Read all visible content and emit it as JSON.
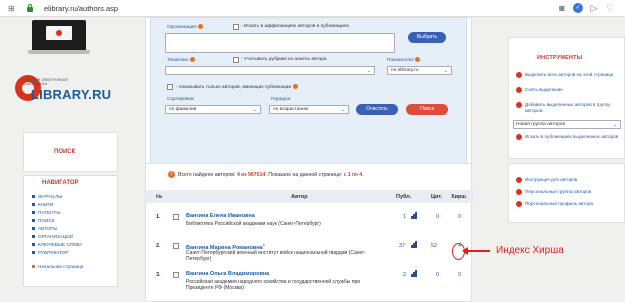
{
  "browser": {
    "url": "elibrary.ru/authors.asp",
    "grid_icon": "grid-icon",
    "lock_icon": "lock-icon"
  },
  "left": {
    "logo_small": "НАУЧНАЯ ЭЛЕКТРОННАЯ БИБЛИОТЕКА",
    "logo_main": "LIBRARY.RU",
    "search_label": "ПОИСК",
    "nav_title": "НАВИГАТОР",
    "nav_items": [
      "ЖУРНАЛЫ",
      "КНИГИ",
      "ПАТЕНТЫ",
      "ПОИСК",
      "АВТОРЫ",
      "ОРГАНИЗАЦИИ",
      "КЛЮЧЕВЫЕ СЛОВА",
      "РУБРИКАТОР"
    ],
    "home": "Начальная страница"
  },
  "form": {
    "org_label": "Организация:",
    "org_checkbox": "- Искать в аффилиациях авторов в публикациях",
    "choose_btn": "Выбрать",
    "topic_label": "Тематика:",
    "topic_checkbox": "- Учитывать рубрики из анкеты автора",
    "indicator_label": "Показатели:",
    "indicator_value": "по elibrary.ru",
    "show_only": "- показывать только авторов, имеющих публикации",
    "sort_label": "Сортировка:",
    "sort_value": "по фамилии",
    "order_label": "Порядок:",
    "order_value": "по возрастанию",
    "clear_btn": "Очистить",
    "search_btn": "Поиск"
  },
  "results": {
    "found_prefix": "Всего найдено авторов:",
    "found_count": "4",
    "found_of": "из",
    "found_total": "967014",
    "shown_text": ". Показано на данной странице: с",
    "shown_from": "1",
    "shown_to_text": "по",
    "shown_to": "4",
    "col_num": "№",
    "col_author": "Автор",
    "col_publ": "Публ.",
    "col_cit": "Цит.",
    "col_hirsh": "Хирш",
    "rows": [
      {
        "num": "1.",
        "name": "Вангина Елена Ивановна",
        "org": "Библиотека Российской академии наук (Санкт-Петербург)",
        "publ": "1",
        "cit": "0",
        "hirsh": "0"
      },
      {
        "num": "2.",
        "name": "Вангина Марина Романовна",
        "org": "Санкт-Петербургский военный институт войск национальной гвардии (Санкт-Петербург)",
        "publ": "37",
        "cit": "52",
        "hirsh": "4"
      },
      {
        "num": "3.",
        "name": "Вангина Ольга Владимировна",
        "org": "Российская академия народного хозяйства и государственной службы при Президенте РФ (Москва)",
        "publ": "2",
        "cit": "0",
        "hirsh": "0"
      }
    ]
  },
  "annotation": {
    "text": "Индекс Хирша",
    "color": "#e02020"
  },
  "tools": {
    "title": "ИНСТРУМЕНТЫ",
    "items": [
      "Выделить всех авторов на этой странице",
      "Снять выделение",
      "Добавить выделенных авторов в группу авторов:"
    ],
    "group_select": "Новая группа авторов",
    "items2": [
      "Искать в публикациях выделенных авторов",
      "Инструкция для авторов",
      "Персональные группы авторов",
      "Персональный профиль автора"
    ]
  }
}
